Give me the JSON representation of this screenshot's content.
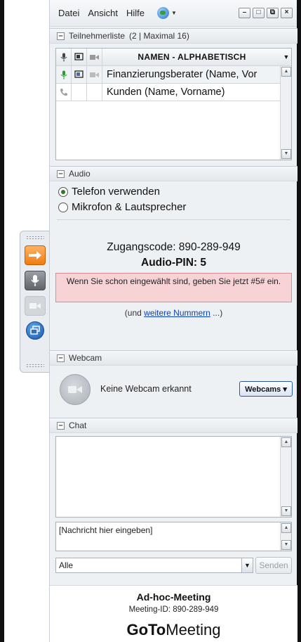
{
  "menu": {
    "items": [
      "Datei",
      "Ansicht",
      "Hilfe"
    ]
  },
  "window_controls": [
    "–",
    "□",
    "⧉",
    "×"
  ],
  "participants": {
    "title": "Teilnehmerliste",
    "count_text": "(2 | Maximal 16)",
    "column_header": "NAMEN - ALPHABETISCH",
    "rows": [
      {
        "name": "Finanzierungsberater (Name, Vor"
      },
      {
        "name": "Kunden (Name, Vorname)"
      }
    ]
  },
  "audio": {
    "title": "Audio",
    "option_phone": "Telefon verwenden",
    "option_mic": "Mikrofon & Lautsprecher",
    "access_code": "Zugangscode: 890-289-949",
    "audio_pin": "Audio-PIN: 5",
    "pin_hint": "Wenn Sie schon eingewählt sind, geben Sie jetzt #5# ein.",
    "more_prefix": "(und ",
    "more_link": "weitere Nummern",
    "more_suffix": " ...)"
  },
  "webcam": {
    "title": "Webcam",
    "status": "Keine Webcam erkannt",
    "button": "Webcams ▾"
  },
  "chat": {
    "title": "Chat",
    "input_placeholder": "[Nachricht hier eingeben]",
    "recipient": "Alle",
    "send": "Senden"
  },
  "footer": {
    "meeting_name": "Ad-hoc-Meeting",
    "meeting_id": "Meeting-ID: 890-289-949",
    "brand_bold": "GoTo",
    "brand_regular": "Meeting"
  },
  "colors": {
    "accent_orange": "#f07c10",
    "link_blue": "#0a3fbf",
    "hint_bg": "#f7d3d6",
    "online_green": "#2c9a2c"
  }
}
